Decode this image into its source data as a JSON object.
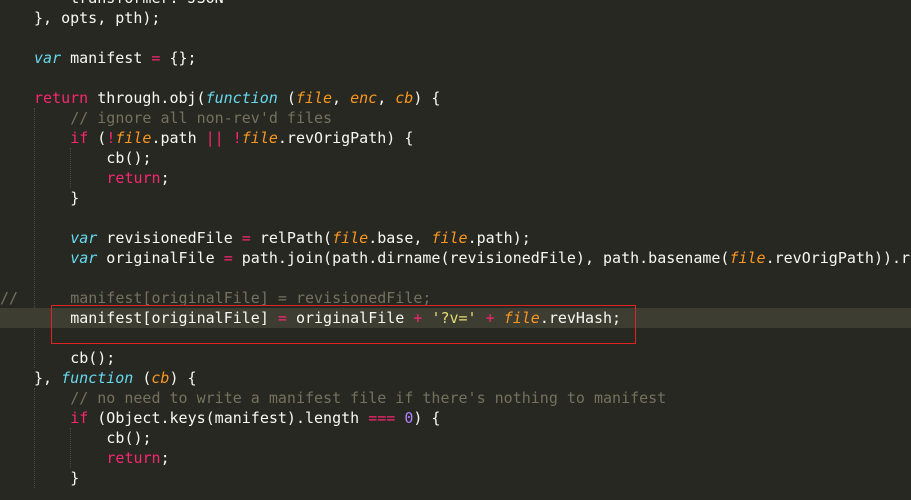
{
  "editor": {
    "language": "javascript",
    "theme_colors": {
      "background": "#272822",
      "keyword": "#f92672",
      "storage": "#66d9ef",
      "parameter": "#fd971f",
      "string": "#e6db74",
      "number": "#ae81ff",
      "comment": "#75715e",
      "text": "#f8f8f2",
      "highlight_box": "#e02424"
    },
    "highlighted_line_index": 16,
    "lines": [
      {
        "indent": 4,
        "gutter": "",
        "tokens": [
          {
            "t": "transformer: JSON",
            "c": "pl"
          }
        ]
      },
      {
        "indent": 0,
        "gutter": "",
        "tokens": [
          {
            "t": "}, opts, pth);",
            "c": "pl"
          }
        ]
      },
      {
        "indent": 0,
        "gutter": "",
        "tokens": []
      },
      {
        "indent": 0,
        "gutter": "",
        "tokens": [
          {
            "t": "var",
            "c": "st"
          },
          {
            "t": " manifest ",
            "c": "pl"
          },
          {
            "t": "=",
            "c": "op"
          },
          {
            "t": " {};",
            "c": "pl"
          }
        ]
      },
      {
        "indent": 0,
        "gutter": "",
        "tokens": []
      },
      {
        "indent": 0,
        "gutter": "",
        "tokens": [
          {
            "t": "return",
            "c": "kw"
          },
          {
            "t": " through.obj(",
            "c": "pl"
          },
          {
            "t": "function",
            "c": "fn"
          },
          {
            "t": " (",
            "c": "pl"
          },
          {
            "t": "file",
            "c": "pa"
          },
          {
            "t": ", ",
            "c": "pl"
          },
          {
            "t": "enc",
            "c": "pa"
          },
          {
            "t": ", ",
            "c": "pl"
          },
          {
            "t": "cb",
            "c": "pa"
          },
          {
            "t": ") {",
            "c": "pl"
          }
        ]
      },
      {
        "indent": 4,
        "gutter": "",
        "tokens": [
          {
            "t": "// ignore all non-rev'd files",
            "c": "cm"
          }
        ]
      },
      {
        "indent": 4,
        "gutter": "",
        "tokens": [
          {
            "t": "if",
            "c": "kw"
          },
          {
            "t": " (",
            "c": "pl"
          },
          {
            "t": "!",
            "c": "op"
          },
          {
            "t": "file",
            "c": "pa"
          },
          {
            "t": ".path ",
            "c": "pl"
          },
          {
            "t": "||",
            "c": "op"
          },
          {
            "t": " ",
            "c": "pl"
          },
          {
            "t": "!",
            "c": "op"
          },
          {
            "t": "file",
            "c": "pa"
          },
          {
            "t": ".revOrigPath) {",
            "c": "pl"
          }
        ]
      },
      {
        "indent": 8,
        "gutter": "",
        "tokens": [
          {
            "t": "cb();",
            "c": "pl"
          }
        ]
      },
      {
        "indent": 8,
        "gutter": "",
        "tokens": [
          {
            "t": "return",
            "c": "kw"
          },
          {
            "t": ";",
            "c": "pl"
          }
        ]
      },
      {
        "indent": 4,
        "gutter": "",
        "tokens": [
          {
            "t": "}",
            "c": "pl"
          }
        ]
      },
      {
        "indent": 0,
        "gutter": "",
        "tokens": []
      },
      {
        "indent": 4,
        "gutter": "",
        "tokens": [
          {
            "t": "var",
            "c": "st"
          },
          {
            "t": " revisionedFile ",
            "c": "pl"
          },
          {
            "t": "=",
            "c": "op"
          },
          {
            "t": " relPath(",
            "c": "pl"
          },
          {
            "t": "file",
            "c": "pa"
          },
          {
            "t": ".base, ",
            "c": "pl"
          },
          {
            "t": "file",
            "c": "pa"
          },
          {
            "t": ".path);",
            "c": "pl"
          }
        ]
      },
      {
        "indent": 4,
        "gutter": "",
        "tokens": [
          {
            "t": "var",
            "c": "st"
          },
          {
            "t": " originalFile ",
            "c": "pl"
          },
          {
            "t": "=",
            "c": "op"
          },
          {
            "t": " path.join(path.dirname(revisionedFile), path.basename(",
            "c": "pl"
          },
          {
            "t": "file",
            "c": "pa"
          },
          {
            "t": ".revOrigPath)).re",
            "c": "pl"
          }
        ]
      },
      {
        "indent": 0,
        "gutter": "",
        "tokens": []
      },
      {
        "indent": 4,
        "gutter": "//",
        "tokens": [
          {
            "t": "manifest[originalFile] = revisionedFile;",
            "c": "cm"
          }
        ]
      },
      {
        "indent": 4,
        "gutter": "",
        "tokens": [
          {
            "t": "manifest[originalFile] ",
            "c": "pl"
          },
          {
            "t": "=",
            "c": "op"
          },
          {
            "t": " originalFile ",
            "c": "pl"
          },
          {
            "t": "+",
            "c": "op"
          },
          {
            "t": " ",
            "c": "pl"
          },
          {
            "t": "'?v='",
            "c": "str"
          },
          {
            "t": " ",
            "c": "pl"
          },
          {
            "t": "+",
            "c": "op"
          },
          {
            "t": " ",
            "c": "pl"
          },
          {
            "t": "file",
            "c": "pa"
          },
          {
            "t": ".revHash;",
            "c": "pl"
          }
        ]
      },
      {
        "indent": 0,
        "gutter": "",
        "tokens": []
      },
      {
        "indent": 4,
        "gutter": "",
        "tokens": [
          {
            "t": "cb();",
            "c": "pl"
          }
        ]
      },
      {
        "indent": 0,
        "gutter": "",
        "tokens": [
          {
            "t": "}, ",
            "c": "pl"
          },
          {
            "t": "function",
            "c": "fn"
          },
          {
            "t": " (",
            "c": "pl"
          },
          {
            "t": "cb",
            "c": "pa"
          },
          {
            "t": ") {",
            "c": "pl"
          }
        ]
      },
      {
        "indent": 4,
        "gutter": "",
        "tokens": [
          {
            "t": "// no need to write a manifest file if there's nothing to manifest",
            "c": "cm"
          }
        ]
      },
      {
        "indent": 4,
        "gutter": "",
        "tokens": [
          {
            "t": "if",
            "c": "kw"
          },
          {
            "t": " (Object.keys(manifest).length ",
            "c": "pl"
          },
          {
            "t": "===",
            "c": "op"
          },
          {
            "t": " ",
            "c": "pl"
          },
          {
            "t": "0",
            "c": "num"
          },
          {
            "t": ") {",
            "c": "pl"
          }
        ]
      },
      {
        "indent": 8,
        "gutter": "",
        "tokens": [
          {
            "t": "cb();",
            "c": "pl"
          }
        ]
      },
      {
        "indent": 8,
        "gutter": "",
        "tokens": [
          {
            "t": "return",
            "c": "kw"
          },
          {
            "t": ";",
            "c": "pl"
          }
        ]
      },
      {
        "indent": 4,
        "gutter": "",
        "tokens": [
          {
            "t": "}",
            "c": "pl"
          }
        ]
      }
    ]
  }
}
